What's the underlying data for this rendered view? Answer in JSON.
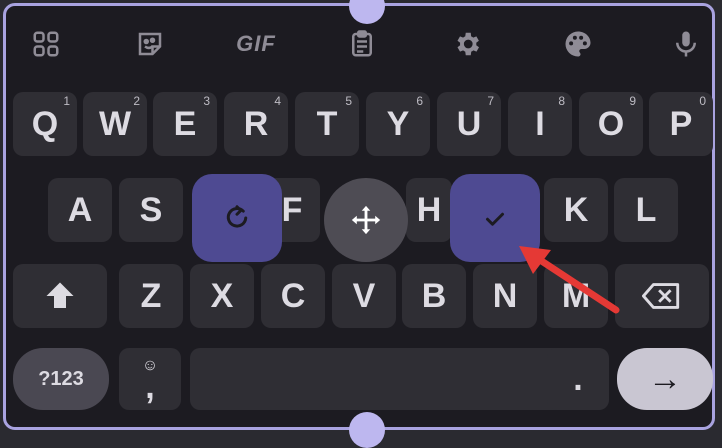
{
  "toolbar": {
    "gif_label": "GIF"
  },
  "keys": {
    "row1": [
      {
        "label": "Q",
        "hint": "1"
      },
      {
        "label": "W",
        "hint": "2"
      },
      {
        "label": "E",
        "hint": "3"
      },
      {
        "label": "R",
        "hint": "4"
      },
      {
        "label": "T",
        "hint": "5"
      },
      {
        "label": "Y",
        "hint": "6"
      },
      {
        "label": "U",
        "hint": "7"
      },
      {
        "label": "I",
        "hint": "8"
      },
      {
        "label": "O",
        "hint": "9"
      },
      {
        "label": "P",
        "hint": "0"
      }
    ],
    "row2": [
      "A",
      "S",
      "F",
      "H",
      "K",
      "L"
    ],
    "row3": [
      "Z",
      "X",
      "C",
      "V",
      "B",
      "N",
      "M"
    ],
    "row4": {
      "symbols": "?123",
      "comma": ",",
      "period": ".",
      "enter": "→"
    }
  },
  "colors": {
    "accent": "#4e4a92",
    "frame": "#a9a3e0",
    "arrow": "#e53935"
  }
}
